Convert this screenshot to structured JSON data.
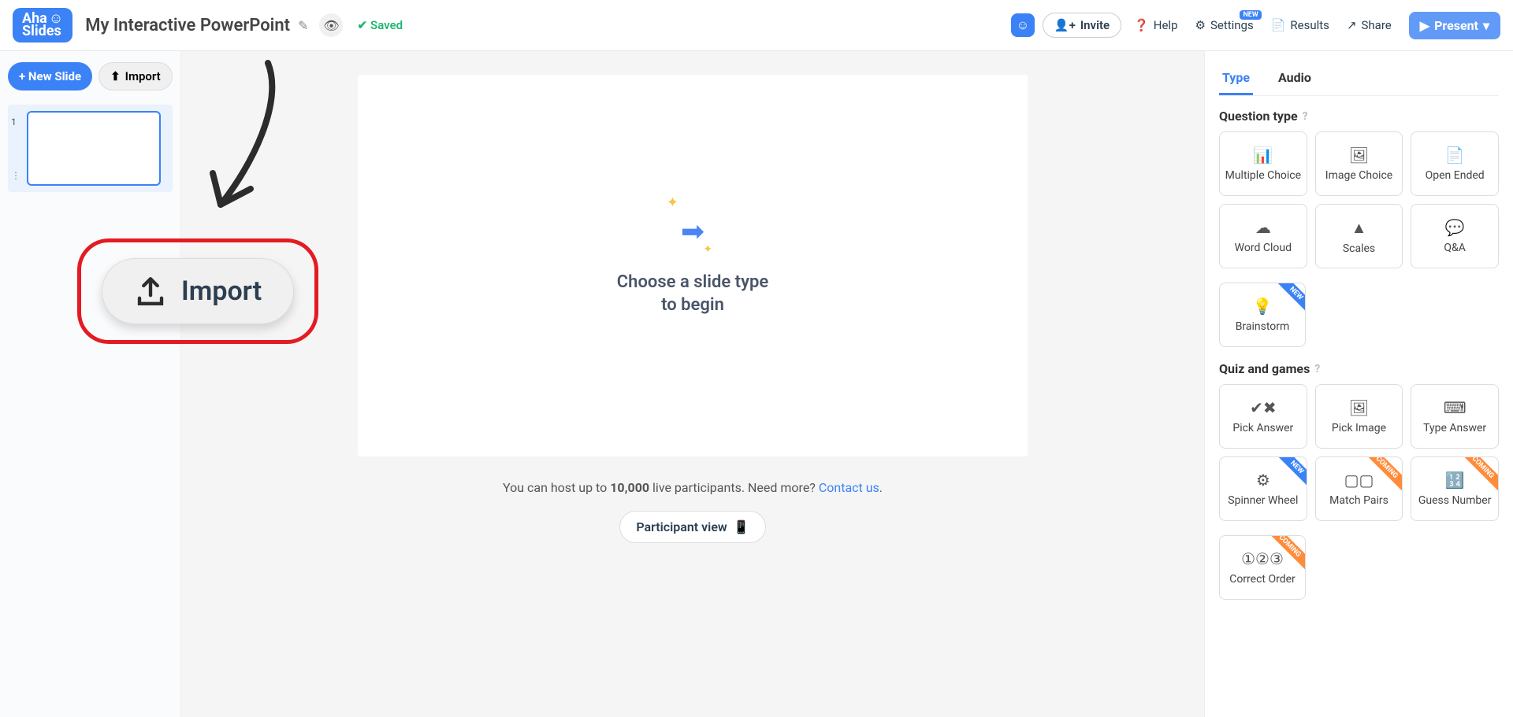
{
  "header": {
    "logo_top": "Aha",
    "logo_bottom": "Slides",
    "title": "My Interactive PowerPoint",
    "saved": "Saved",
    "invite": "Invite",
    "help": "Help",
    "settings": "Settings",
    "settings_badge": "NEW",
    "results": "Results",
    "share": "Share",
    "present": "Present"
  },
  "left": {
    "new_slide": "+ New Slide",
    "import": "Import",
    "slide_num": "1"
  },
  "center": {
    "choose_line1": "Choose a slide type",
    "choose_line2": "to begin",
    "host_prefix": "You can host up to ",
    "host_count": "10,000",
    "host_suffix": " live participants. Need more? ",
    "contact": "Contact us",
    "participant": "Participant view",
    "import_big": "Import"
  },
  "right": {
    "tab_type": "Type",
    "tab_audio": "Audio",
    "section_q": "Question type",
    "section_quiz": "Quiz and games",
    "badge_new": "NEW",
    "badge_coming": "COMING",
    "types": {
      "mc": "Multiple Choice",
      "ic": "Image Choice",
      "oe": "Open Ended",
      "wc": "Word Cloud",
      "sc": "Scales",
      "qa": "Q&A",
      "bs": "Brainstorm"
    },
    "games": {
      "pa": "Pick Answer",
      "pi": "Pick Image",
      "ta": "Type Answer",
      "sw": "Spinner Wheel",
      "mp": "Match Pairs",
      "gn": "Guess Number",
      "co": "Correct Order"
    }
  }
}
